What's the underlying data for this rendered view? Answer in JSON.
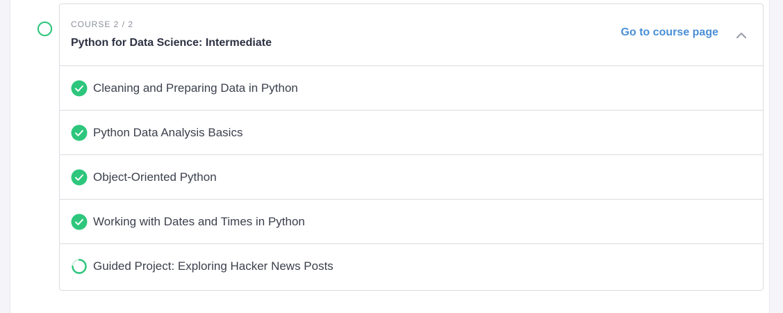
{
  "course": {
    "label": "COURSE 2 / 2",
    "title": "Python for Data Science: Intermediate",
    "link_label": "Go to course page",
    "progress_state": "in-progress",
    "expanded": true
  },
  "lessons": [
    {
      "label": "Cleaning and Preparing Data in Python",
      "status": "completed",
      "icon": "check-circle-icon"
    },
    {
      "label": "Python Data Analysis Basics",
      "status": "completed",
      "icon": "check-circle-icon"
    },
    {
      "label": "Object-Oriented Python",
      "status": "completed",
      "icon": "check-circle-icon"
    },
    {
      "label": "Working with Dates and Times in Python",
      "status": "completed",
      "icon": "check-circle-icon"
    },
    {
      "label": "Guided Project: Exploring Hacker News Posts",
      "status": "in-progress",
      "icon": "in-progress-ring-icon"
    }
  ],
  "colors": {
    "accent_green": "#2dc67c",
    "link_blue": "#4a8fd6",
    "title_dark": "#2d3142",
    "muted_gray": "#8a8f99",
    "border": "#dcdce2"
  }
}
